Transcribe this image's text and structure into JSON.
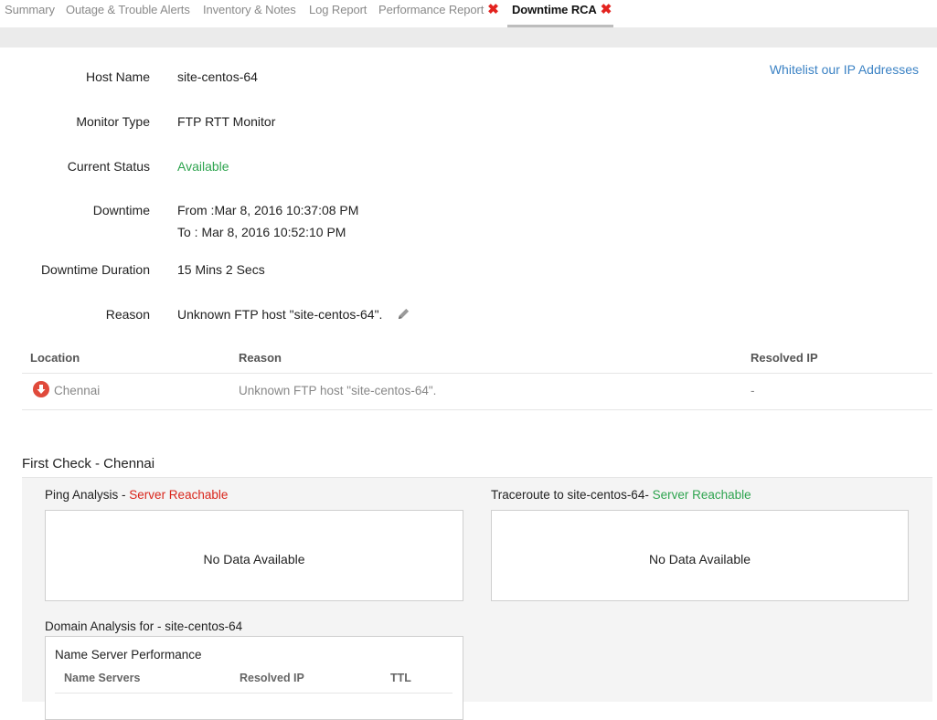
{
  "tabs": [
    {
      "label": "Summary"
    },
    {
      "label": "Outage & Trouble Alerts"
    },
    {
      "label": "Inventory & Notes"
    },
    {
      "label": "Log Report"
    },
    {
      "label": "Performance Report",
      "close": "✖"
    },
    {
      "label": "Downtime RCA",
      "close": "✖",
      "active": true
    }
  ],
  "details": {
    "whitelist_link": "Whitelist our IP Addresses",
    "host_name_label": "Host Name",
    "host_name_value": "site-centos-64",
    "monitor_type_label": "Monitor Type",
    "monitor_type_value": "FTP RTT Monitor",
    "current_status_label": "Current Status",
    "current_status_value": "Available",
    "downtime_label": "Downtime",
    "downtime_from": "From :Mar 8, 2016 10:37:08 PM",
    "downtime_to": "To : Mar 8, 2016 10:52:10 PM",
    "duration_label": "Downtime Duration",
    "duration_value": "15 Mins 2 Secs",
    "reason_label": "Reason",
    "reason_value": "Unknown FTP host \"site-centos-64\"."
  },
  "location_table": {
    "headers": [
      "Location",
      "Reason",
      "Resolved IP"
    ],
    "rows": [
      {
        "location": "Chennai",
        "reason": "Unknown FTP host \"site-centos-64\".",
        "resolved_ip": "-"
      }
    ]
  },
  "first_check": {
    "title": "First Check - Chennai",
    "ping": {
      "label": "Ping Analysis - ",
      "status": "Server Reachable",
      "no_data": "No Data Available"
    },
    "traceroute": {
      "label": "Traceroute to site-centos-64- ",
      "status": "Server Reachable",
      "no_data": "No Data Available"
    },
    "domain": {
      "label": "Domain Analysis for - site-centos-64",
      "ns_title": "Name Server Performance",
      "headers": [
        "Name Servers",
        "Resolved IP",
        "TTL"
      ]
    }
  },
  "colors": {
    "link": "#3b82c4",
    "available": "#2ea44f",
    "alert": "#d9261c",
    "close": "#e3231f"
  }
}
